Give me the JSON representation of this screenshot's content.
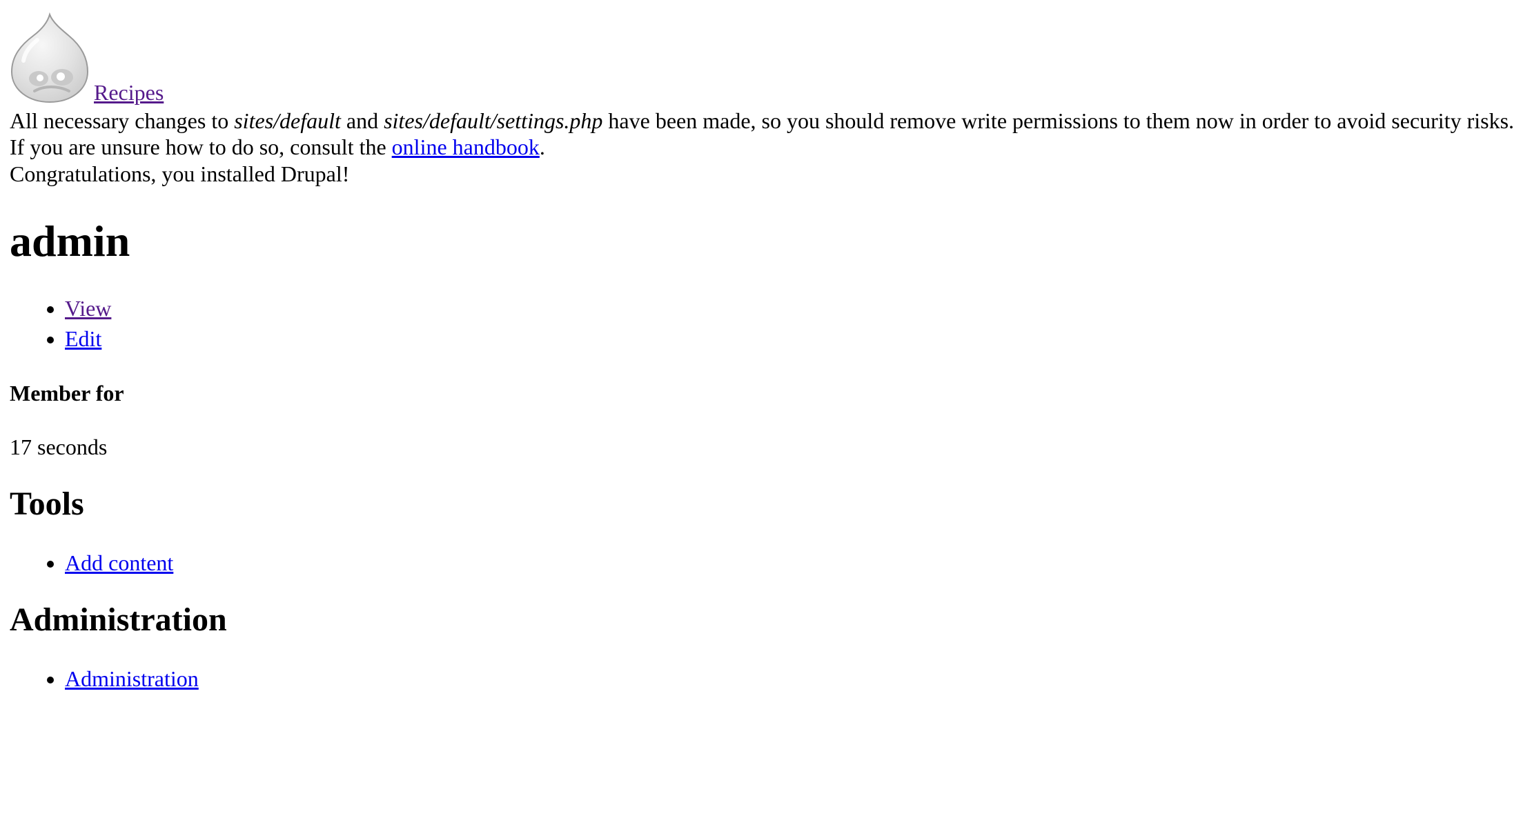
{
  "header": {
    "site_name": "Recipes",
    "logo_icon": "drupal-drop-icon"
  },
  "messages": {
    "status_part1": "All necessary changes to ",
    "status_path1": "sites/default",
    "status_part2": " and ",
    "status_path2": "sites/default/settings.php",
    "status_part3": " have been made, so you should remove write permissions to them now in order to avoid security risks. If you are unsure how to do so, consult the ",
    "handbook_link": "online handbook",
    "status_part4": ".",
    "congrats": "Congratulations, you installed Drupal!"
  },
  "page": {
    "title": "admin",
    "tabs": [
      {
        "label": "View"
      },
      {
        "label": "Edit"
      }
    ],
    "member_for_label": "Member for",
    "member_for_value": "17 seconds"
  },
  "tools": {
    "title": "Tools",
    "items": [
      {
        "label": "Add content"
      }
    ]
  },
  "administration": {
    "title": "Administration",
    "items": [
      {
        "label": "Administration"
      }
    ]
  },
  "colors": {
    "link": "#0000ee",
    "visited_link": "#551a8b",
    "text": "#000000",
    "background": "#ffffff"
  }
}
